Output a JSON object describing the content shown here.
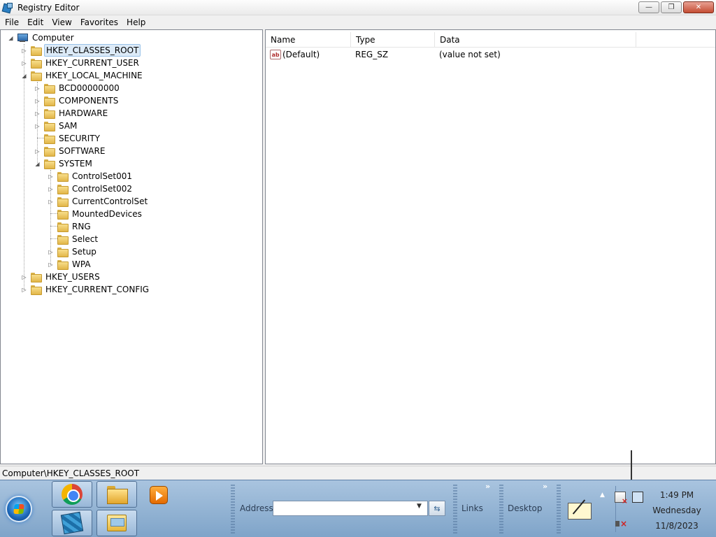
{
  "window": {
    "title": "Registry Editor",
    "min": "—",
    "max": "❐",
    "close": "✕"
  },
  "menu": [
    "File",
    "Edit",
    "View",
    "Favorites",
    "Help"
  ],
  "tree": {
    "computer": "Computer",
    "hkcr": "HKEY_CLASSES_ROOT",
    "hkcu": "HKEY_CURRENT_USER",
    "hklm": "HKEY_LOCAL_MACHINE",
    "hklm_children": [
      "BCD00000000",
      "COMPONENTS",
      "HARDWARE",
      "SAM",
      "SECURITY",
      "SOFTWARE",
      "SYSTEM"
    ],
    "system_children": [
      "ControlSet001",
      "ControlSet002",
      "CurrentControlSet",
      "MountedDevices",
      "RNG",
      "Select",
      "Setup",
      "WPA"
    ],
    "hku": "HKEY_USERS",
    "hkcc": "HKEY_CURRENT_CONFIG",
    "expanded_glyph": "◢",
    "collapsed_glyph": "▷"
  },
  "list": {
    "headers": [
      "Name",
      "Type",
      "Data"
    ],
    "rows": [
      {
        "icon": "ab",
        "name": "(Default)",
        "type": "REG_SZ",
        "data": "(value not set)"
      }
    ]
  },
  "status": {
    "path": "Computer\\HKEY_CLASSES_ROOT"
  },
  "taskbar": {
    "address_label": "Address",
    "address_value": "",
    "links_label": "Links",
    "desktop_label": "Desktop",
    "chevron": "»",
    "dropdown_glyph": "▼",
    "go_glyph": "⇆",
    "tray_show": "▲"
  },
  "clock": {
    "time": "1:49 PM",
    "day": "Wednesday",
    "date": "11/8/2023"
  }
}
